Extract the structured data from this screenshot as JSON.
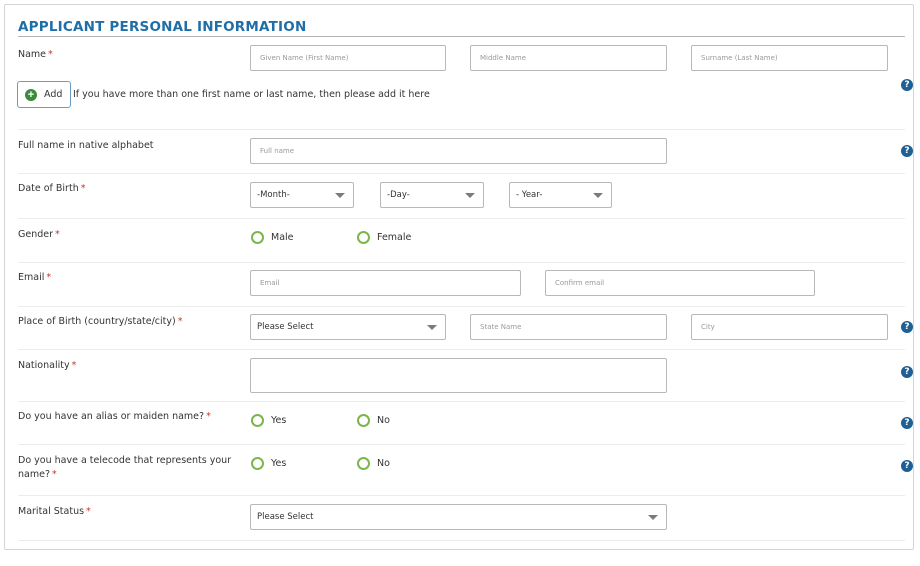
{
  "section": {
    "title": "APPLICANT PERSONAL INFORMATION"
  },
  "required_mark": "*",
  "help_glyph": "?",
  "name": {
    "label": "Name",
    "given_placeholder": "Given Name (First Name)",
    "middle_placeholder": "Middle Name",
    "surname_placeholder": "Surname (Last Name)",
    "add_label": "Add",
    "add_icon": "plus-circle-icon",
    "add_hint": "If you have more than one first name or last name, then please add it here"
  },
  "native_name": {
    "label": "Full name in native alphabet",
    "placeholder": "Full name"
  },
  "dob": {
    "label": "Date of Birth",
    "month": "-Month-",
    "day": "-Day-",
    "year": "- Year-"
  },
  "gender": {
    "label": "Gender",
    "options": [
      "Male",
      "Female"
    ]
  },
  "email": {
    "label": "Email",
    "placeholder": "Email",
    "confirm_placeholder": "Confirm email"
  },
  "birthplace": {
    "label": "Place of Birth (country/state/city)",
    "country": "Please Select",
    "state_placeholder": "State Name",
    "city_placeholder": "City"
  },
  "nationality": {
    "label": "Nationality"
  },
  "alias": {
    "label": "Do you have an alias or maiden name?",
    "options": [
      "Yes",
      "No"
    ]
  },
  "telecode": {
    "label_line1": "Do you have a telecode that represents your",
    "label_line2": "name?",
    "options": [
      "Yes",
      "No"
    ]
  },
  "marital": {
    "label": "Marital Status",
    "value": "Please Select"
  },
  "colors": {
    "title": "#1f6ea8",
    "required": "#c0392b",
    "radio_ring": "#7ab648",
    "help_icon": "#1f5f95",
    "add_icon": "#3a8b3a"
  }
}
